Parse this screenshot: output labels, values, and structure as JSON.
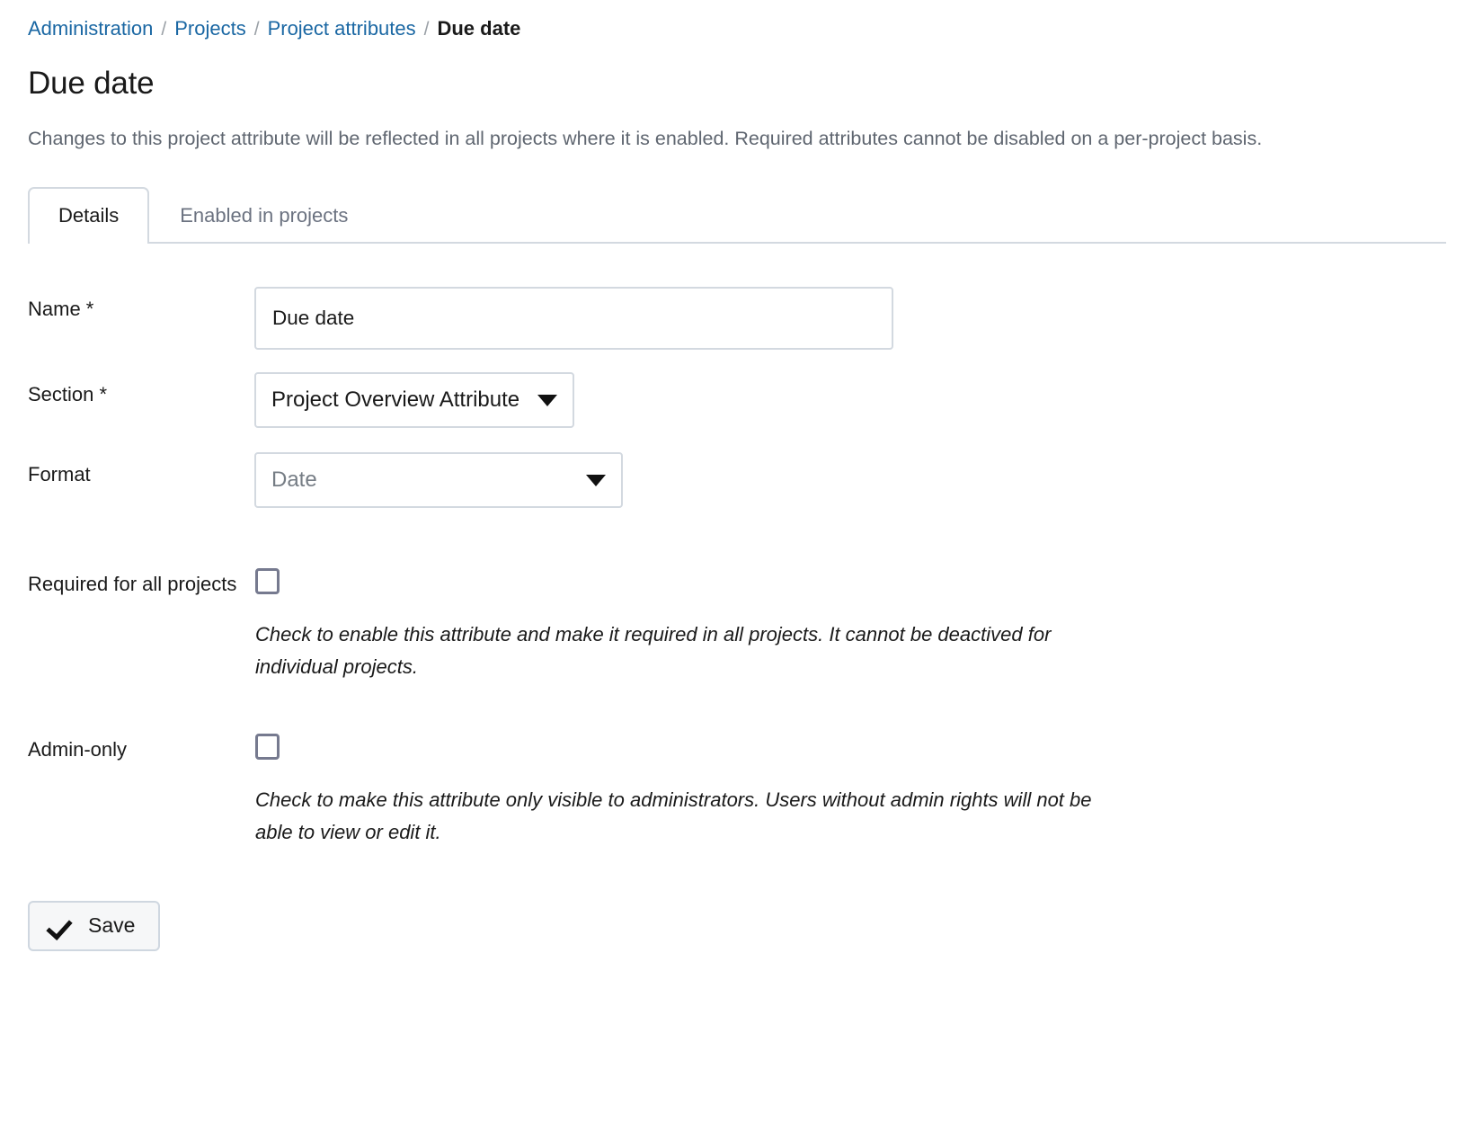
{
  "breadcrumb": {
    "separator": "/",
    "items": [
      {
        "label": "Administration",
        "current": false
      },
      {
        "label": "Projects",
        "current": false
      },
      {
        "label": "Project attributes",
        "current": false
      },
      {
        "label": "Due date",
        "current": true
      }
    ]
  },
  "header": {
    "title": "Due date",
    "description": "Changes to this project attribute will be reflected in all projects where it is enabled. Required attributes cannot be disabled on a per-project basis."
  },
  "tabs": [
    {
      "label": "Details",
      "active": true
    },
    {
      "label": "Enabled in projects",
      "active": false
    }
  ],
  "form": {
    "name": {
      "label": "Name *",
      "value": "Due date",
      "placeholder": ""
    },
    "section": {
      "label": "Section *",
      "value": "Project Overview Attribute",
      "icon": "chevron-down-icon"
    },
    "format": {
      "label": "Format",
      "value": "Date",
      "icon": "chevron-down-icon",
      "disabled": true
    },
    "required_for_all_projects": {
      "label": "Required for all projects",
      "checked": false,
      "hint": "Check to enable this attribute and make it required in all projects. It cannot be deactived for individual projects."
    },
    "admin_only": {
      "label": "Admin-only",
      "checked": false,
      "hint": "Check to make this attribute only visible to administrators. Users without admin rights will not be able to view or edit it."
    }
  },
  "actions": {
    "save_label": "Save",
    "save_icon": "checkmark-icon"
  },
  "colors": {
    "link": "#1a67a3",
    "text": "#1a1a1a",
    "muted": "#5f6670",
    "border": "#d3d9e0",
    "checkbox_border": "#767a8f",
    "button_bg": "#f6f7f8"
  }
}
